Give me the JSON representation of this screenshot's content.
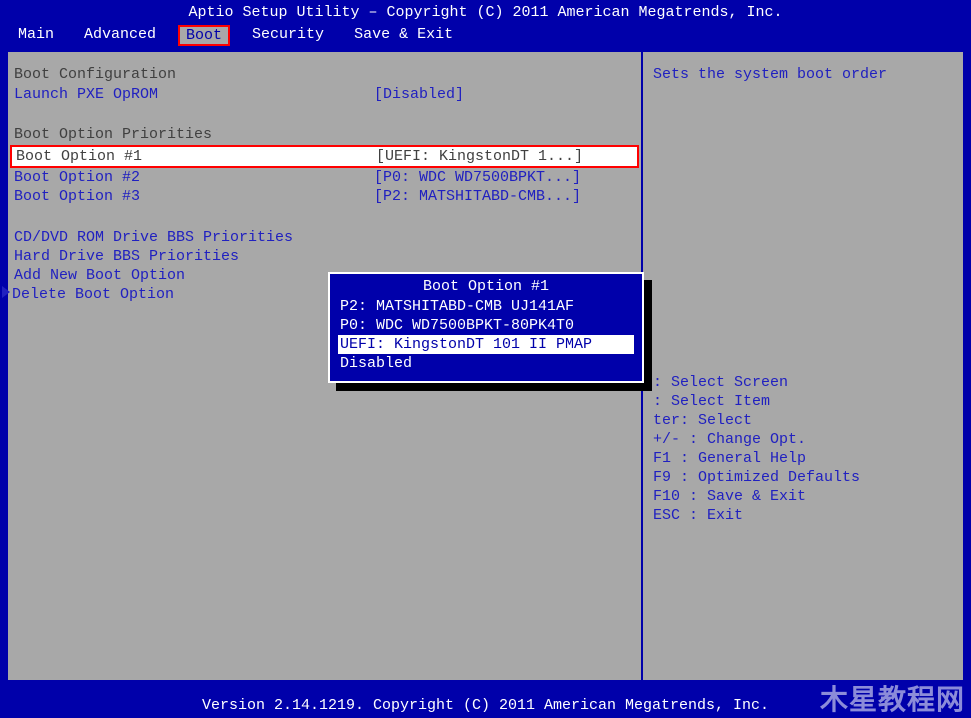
{
  "header": {
    "title": "Aptio Setup Utility – Copyright (C) 2011 American Megatrends, Inc."
  },
  "tabs": {
    "items": [
      {
        "label": "Main"
      },
      {
        "label": "Advanced"
      },
      {
        "label": "Boot"
      },
      {
        "label": "Security"
      },
      {
        "label": "Save & Exit"
      }
    ]
  },
  "left": {
    "section1_title": "Boot Configuration",
    "pxe_label": "Launch PXE OpROM",
    "pxe_value": "[Disabled]",
    "section2_title": "Boot Option Priorities",
    "opt1_label": "Boot Option #1",
    "opt1_value": "[UEFI: KingstonDT 1...]",
    "opt2_label": "Boot Option #2",
    "opt2_value": "[P0: WDC WD7500BPKT...]",
    "opt3_label": "Boot Option #3",
    "opt3_value": "[P2: MATSHITABD-CMB...]",
    "cddvd": "CD/DVD ROM Drive BBS Priorities",
    "hdd": "Hard Drive BBS Priorities",
    "addnew": "Add New Boot Option",
    "delete": "Delete Boot Option"
  },
  "popup": {
    "title": "Boot Option #1",
    "items": [
      "P2: MATSHITABD-CMB UJ141AF",
      "P0: WDC WD7500BPKT-80PK4T0",
      "UEFI: KingstonDT 101 II PMAP",
      "Disabled"
    ]
  },
  "right": {
    "description": "Sets the system boot order",
    "help": [
      "      : Select Screen",
      "      : Select Item",
      "ter: Select",
      "+/-   : Change Opt.",
      "F1    : General Help",
      "F9    : Optimized Defaults",
      "F10   : Save & Exit",
      "ESC   : Exit"
    ]
  },
  "footer": {
    "text": "Version 2.14.1219. Copyright (C) 2011 American Megatrends, Inc."
  },
  "watermark": "木星教程网"
}
